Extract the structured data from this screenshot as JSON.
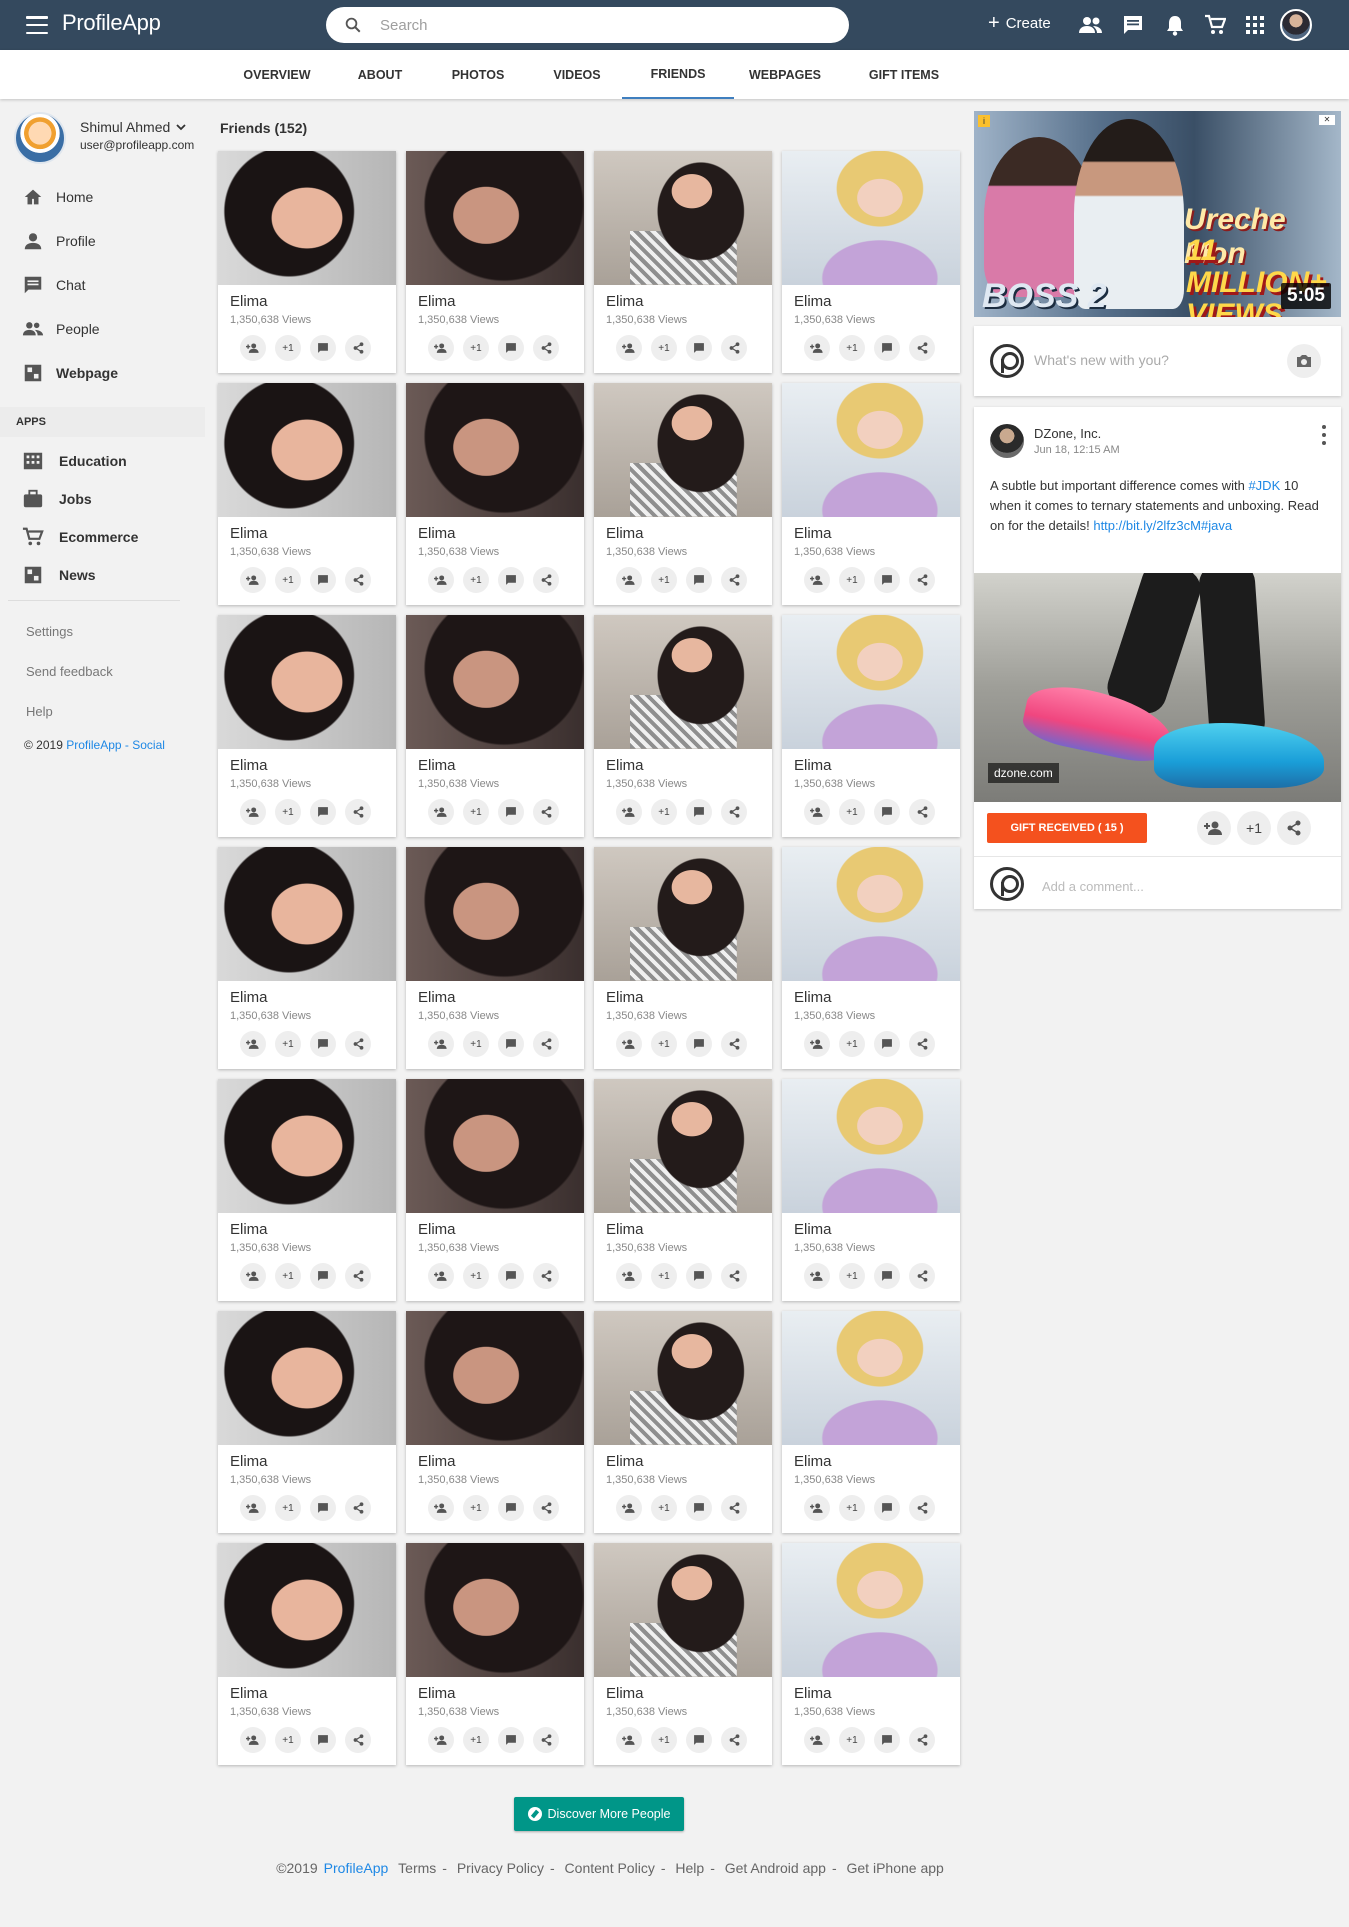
{
  "app": {
    "logo_text": "ProfileApp"
  },
  "topbar": {
    "search_placeholder": "Search",
    "create_label": "Create",
    "icons": [
      "people-icon",
      "chat-icon",
      "bell-icon",
      "cart-icon",
      "apps-grid-icon",
      "user-avatar"
    ]
  },
  "tabs": [
    {
      "label": "OVERVIEW"
    },
    {
      "label": "ABOUT"
    },
    {
      "label": "PHOTOS"
    },
    {
      "label": "VIDEOS"
    },
    {
      "label": "FRIENDS",
      "active": true
    },
    {
      "label": "WEBPAGES"
    },
    {
      "label": "GIFT ITEMS"
    }
  ],
  "sidebar": {
    "user_name": "Shimul Ahmed",
    "user_email": "user@profileapp.com",
    "nav": [
      {
        "label": "Home",
        "icon": "home-icon"
      },
      {
        "label": "Profile",
        "icon": "person-icon"
      },
      {
        "label": "Chat",
        "icon": "chat-icon"
      },
      {
        "label": "People",
        "icon": "people-icon"
      },
      {
        "label": "Webpage",
        "icon": "webpage-icon"
      }
    ],
    "apps_header": "APPS",
    "apps": [
      {
        "label": "Education",
        "icon": "building-icon"
      },
      {
        "label": "Jobs",
        "icon": "briefcase-icon"
      },
      {
        "label": "Ecommerce",
        "icon": "cart-icon"
      },
      {
        "label": "News",
        "icon": "news-icon"
      }
    ],
    "links": [
      "Settings",
      "Send feedback",
      "Help"
    ],
    "copyright_prefix": "© 2019",
    "copyright_brand": "ProfileApp - Social"
  },
  "friends": {
    "header": "Friends (152)",
    "card": {
      "name": "Elima",
      "views": "1,350,638 Views",
      "plus_one": "+1"
    },
    "rows": 7,
    "cols": 4
  },
  "ad": {
    "title": "Ureche Mon",
    "subtitle": "11 MILLION+ VIEWS",
    "movie": "BOSS 2",
    "duration": "5:05"
  },
  "composer": {
    "placeholder": "What's new with you?"
  },
  "post": {
    "author": "DZone, Inc.",
    "date": "Jun 18, 12:15 AM",
    "text_1": "A subtle but important difference comes with ",
    "hashtag_1": "#JDK",
    "text_2": " 10 when it comes to ternary statements and unboxing. Read on for the details! ",
    "link": "http://bit.ly/2lfz3cM",
    "hashtag_2": "#java",
    "image_label": "dzone.com",
    "gift_button": "GIFT RECEIVED ( 15 )",
    "plus_one": "+1",
    "comment_placeholder": "Add a comment..."
  },
  "discover_button": "Discover More People",
  "footer": {
    "copyright": "©2019",
    "brand": "ProfileApp",
    "links": [
      "Terms",
      "Privacy Policy",
      "Content Policy",
      "Help",
      "Get Android app",
      "Get iPhone app"
    ]
  },
  "colors": {
    "topbar": "#34495e",
    "accent": "#1e88e5",
    "gift": "#f4511e",
    "discover": "#009688"
  }
}
